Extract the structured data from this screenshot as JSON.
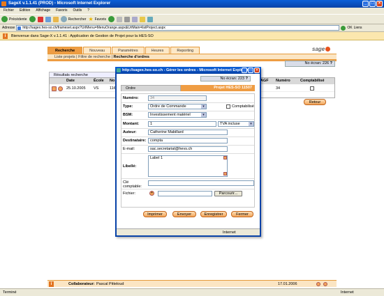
{
  "browser": {
    "title": "SageX v.1.1.41 (PROD) - Microsoft Internet Explorer",
    "menu": [
      "Fichier",
      "Edition",
      "Affichage",
      "Favoris",
      "Outils",
      "?"
    ],
    "back_label": "Précédente",
    "search_label": "Rechercher",
    "favorites_label": "Favoris",
    "address_label": "Adresse",
    "url": "http://sagex.hes-so.ch/frameset.aspx?UrlMenu=MenuOrange.aspx&UrlMain=listProject.aspx",
    "ok_label": "OK",
    "links_label": "Liens",
    "status_left": "Terminé",
    "status_right": "Internet"
  },
  "info_bar": {
    "badge": "i",
    "text": "Bienvenue dans Sage-X v.1.1.41 : Application de Gestion de Projet pour la HES-SO"
  },
  "app": {
    "tabs": [
      "Recherche",
      "Nouveau",
      "Paramètres",
      "Heures",
      "Reporting"
    ],
    "logo": "sage",
    "subnav": {
      "items": [
        "Liste projets",
        "Filtre de recherche"
      ],
      "current": "Recherche d'ordres"
    },
    "ecran": "No écran: 226",
    "ecran_help": "?",
    "results": {
      "title": "Résultats recherche",
      "columns": [
        "Date",
        "École",
        "No",
        "AGF",
        "Numéro",
        "Comptabilisé"
      ],
      "row": {
        "date": "25.10.2005",
        "ecole": "VS",
        "no": "11€",
        "agf": "",
        "numero": "34"
      }
    },
    "retour_label": "Retour",
    "collaborateur_label": "Collaborateur:",
    "collaborateur_name": "Pascal Pitteloud",
    "date": "17.01.2006"
  },
  "popup": {
    "title": "http://sagex.hes-so.ch - Gérer les ordres - Microsoft Internet Explorer",
    "ecran": "No écran: 223",
    "ecran_help": "?",
    "tab_ordre": "Ordre",
    "tab_projet": "Projet HES-SO 11507",
    "form": {
      "numero_label": "Numéro:",
      "numero": "34",
      "type_label": "Type:",
      "type": "Ordre de Commande",
      "comptabilise_label": "Comptabilisé",
      "bsm_label": "BSM:",
      "bsm": "Investissement matériel",
      "montant_label": "Montant:",
      "montant": "1",
      "tva": "TVA incluse",
      "auteur_label": "Auteur:",
      "auteur": "Catherine Mabillard",
      "destinataire_label": "Destinataire:",
      "destinataire": "compta",
      "email_label": "E-mail:",
      "email": "sac.secretariat@hevs.ch",
      "libelle_label": "Libellé:",
      "libelle": "Label 1",
      "cle_label": "Clé comptable:",
      "cle": "",
      "fichier_label": "Fichier:",
      "fichier": "",
      "parcourir_label": "Parcourir..."
    },
    "buttons": [
      "Imprimer",
      "Envoyer",
      "Enregistrer",
      "Fermer"
    ],
    "status_right": "Internet"
  },
  "colors": {
    "orange": "#ef9d44",
    "xp_blue": "#0842a8"
  }
}
